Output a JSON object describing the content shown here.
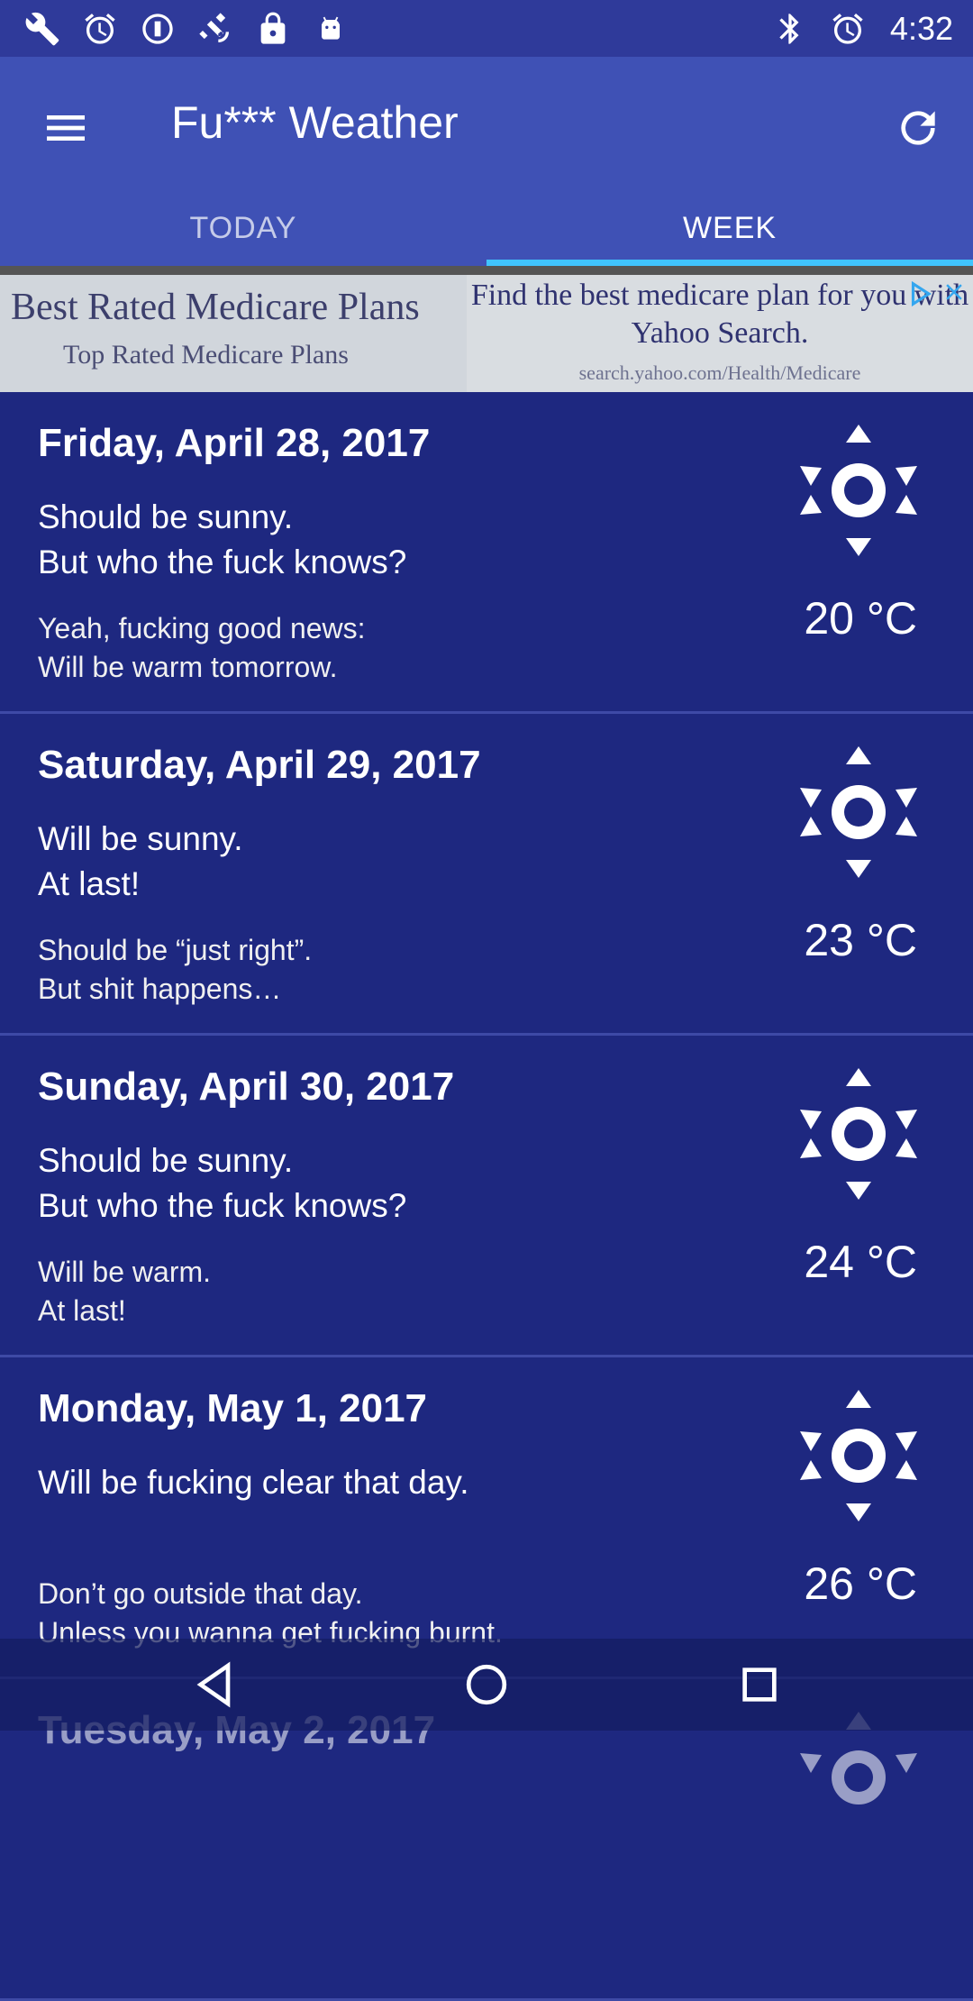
{
  "status_bar": {
    "left_icons": [
      "wrench-icon",
      "alarm-icon",
      "info-circle-icon",
      "satellite-icon",
      "lock-icon",
      "android-icon"
    ],
    "right_icons": [
      "bluetooth-icon",
      "alarm-icon"
    ],
    "time": "4:32"
  },
  "app_bar": {
    "title": "Fu*** Weather",
    "tabs": [
      {
        "label": "TODAY",
        "active": false
      },
      {
        "label": "WEEK",
        "active": true
      }
    ]
  },
  "ad": {
    "headline": "Best Rated Medicare Plans",
    "sub": "Top Rated Medicare Plans",
    "text": "Find the best medicare plan for you with Yahoo Search.",
    "url": "search.yahoo.com/Health/Medicare"
  },
  "days": [
    {
      "date": "Friday, April 28, 2017",
      "description": "Should be sunny.\nBut who the fuck knows?",
      "comment": "Yeah, fucking good news:\nWill be warm tomorrow.",
      "temp": "20 °C",
      "icon": "sun-icon"
    },
    {
      "date": "Saturday, April 29, 2017",
      "description": "Will be sunny.\nAt last!",
      "comment": "Should be “just right”.\nBut shit happens…",
      "temp": "23 °C",
      "icon": "sun-icon"
    },
    {
      "date": "Sunday, April 30, 2017",
      "description": "Should be sunny.\nBut who the fuck knows?",
      "comment": "Will be warm.\nAt last!",
      "temp": "24 °C",
      "icon": "sun-icon"
    },
    {
      "date": "Monday, May 1, 2017",
      "description": "Will be fucking clear that day.",
      "comment": "Don’t go outside that day.\nUnless you wanna get fucking burnt.",
      "temp": "26 °C",
      "icon": "sun-icon"
    },
    {
      "date": "Tuesday, May 2, 2017",
      "icon": "sun-icon"
    }
  ],
  "nav_bar": {
    "buttons": [
      "back-icon",
      "home-icon",
      "recents-icon"
    ]
  },
  "colors": {
    "status_bar": "#2f3a9a",
    "app_bar": "#3f51b5",
    "tab_indicator": "#40c4ff",
    "list_background": "#1e2880"
  }
}
